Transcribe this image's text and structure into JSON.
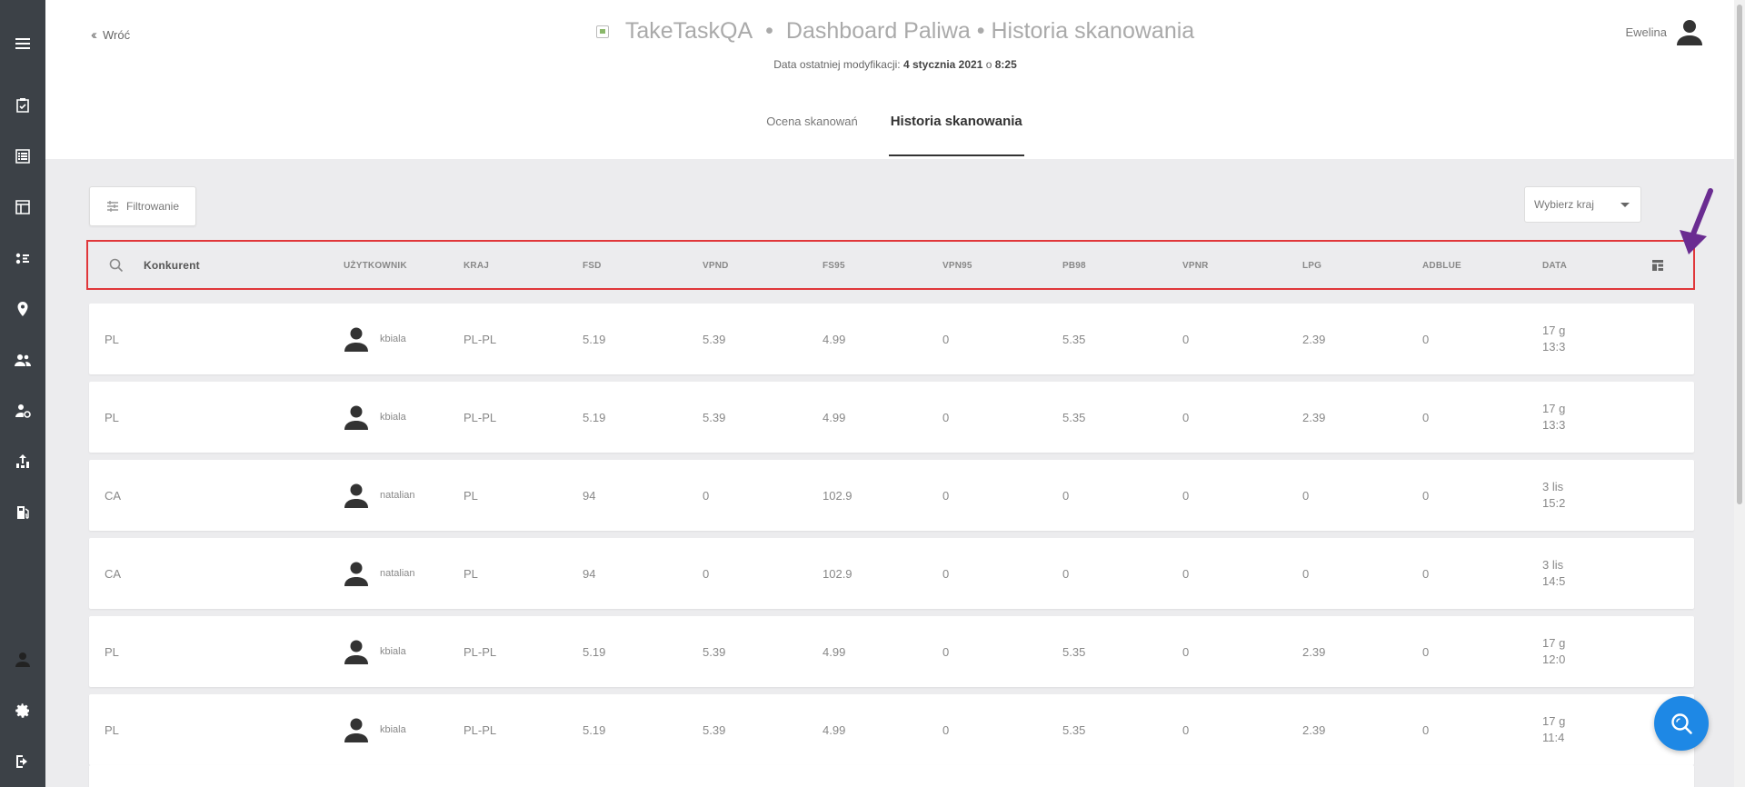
{
  "sidebar": {
    "items": [
      {
        "icon": "menu-icon"
      },
      {
        "icon": "checklist-icon"
      },
      {
        "icon": "list-icon"
      },
      {
        "icon": "layout-icon"
      },
      {
        "icon": "network-icon"
      },
      {
        "icon": "location-pin-icon"
      },
      {
        "icon": "users-icon"
      },
      {
        "icon": "user-settings-icon"
      },
      {
        "icon": "upload-chart-icon"
      },
      {
        "icon": "fuel-pump-icon"
      },
      {
        "icon": "profile-icon"
      },
      {
        "icon": "gear-icon"
      },
      {
        "icon": "logout-icon"
      }
    ]
  },
  "header": {
    "back_label": "Wróć",
    "app_name": "TakeTaskQA",
    "separator": "•",
    "page_title": "Dashboard Paliwa • Historia skanowania",
    "modified_prefix": "Data ostatniej modyfikacji:",
    "modified_date": "4 stycznia 2021",
    "modified_at": "o",
    "modified_time": "8:25",
    "user_name": "Ewelina"
  },
  "tabs": [
    {
      "label": "Ocena skanowań",
      "active": false
    },
    {
      "label": "Historia skanowania",
      "active": true
    }
  ],
  "controls": {
    "filter_label": "Filtrowanie",
    "country_placeholder": "Wybierz kraj"
  },
  "table": {
    "columns": [
      "Konkurent",
      "UŻYTKOWNIK",
      "KRAJ",
      "FSD",
      "VPND",
      "FS95",
      "VPN95",
      "PB98",
      "VPNR",
      "LPG",
      "ADBLUE",
      "DATA"
    ],
    "rows": [
      {
        "konkurent": "PL",
        "user": "kbiala",
        "kraj": "PL-PL",
        "fsd": "5.19",
        "vpnd": "5.39",
        "fs95": "4.99",
        "vpn95": "0",
        "pb98": "5.35",
        "vpnr": "0",
        "lpg": "2.39",
        "adblue": "0",
        "date1": "17 g",
        "date2": "13:3"
      },
      {
        "konkurent": "PL",
        "user": "kbiala",
        "kraj": "PL-PL",
        "fsd": "5.19",
        "vpnd": "5.39",
        "fs95": "4.99",
        "vpn95": "0",
        "pb98": "5.35",
        "vpnr": "0",
        "lpg": "2.39",
        "adblue": "0",
        "date1": "17 g",
        "date2": "13:3"
      },
      {
        "konkurent": "CA",
        "user": "natalian",
        "kraj": "PL",
        "fsd": "94",
        "vpnd": "0",
        "fs95": "102.9",
        "vpn95": "0",
        "pb98": "0",
        "vpnr": "0",
        "lpg": "0",
        "adblue": "0",
        "date1": "3 lis",
        "date2": "15:2"
      },
      {
        "konkurent": "CA",
        "user": "natalian",
        "kraj": "PL",
        "fsd": "94",
        "vpnd": "0",
        "fs95": "102.9",
        "vpn95": "0",
        "pb98": "0",
        "vpnr": "0",
        "lpg": "0",
        "adblue": "0",
        "date1": "3 lis",
        "date2": "14:5"
      },
      {
        "konkurent": "PL",
        "user": "kbiala",
        "kraj": "PL-PL",
        "fsd": "5.19",
        "vpnd": "5.39",
        "fs95": "4.99",
        "vpn95": "0",
        "pb98": "5.35",
        "vpnr": "0",
        "lpg": "2.39",
        "adblue": "0",
        "date1": "17 g",
        "date2": "12:0"
      },
      {
        "konkurent": "PL",
        "user": "kbiala",
        "kraj": "PL-PL",
        "fsd": "5.19",
        "vpnd": "5.39",
        "fs95": "4.99",
        "vpn95": "0",
        "pb98": "5.35",
        "vpnr": "0",
        "lpg": "2.39",
        "adblue": "0",
        "date1": "17 g",
        "date2": "11:4"
      }
    ]
  },
  "colors": {
    "sidebar_bg": "#3c4147",
    "highlight_border": "#e0373a",
    "arrow": "#6a2c91",
    "fab": "#1e88e5"
  }
}
